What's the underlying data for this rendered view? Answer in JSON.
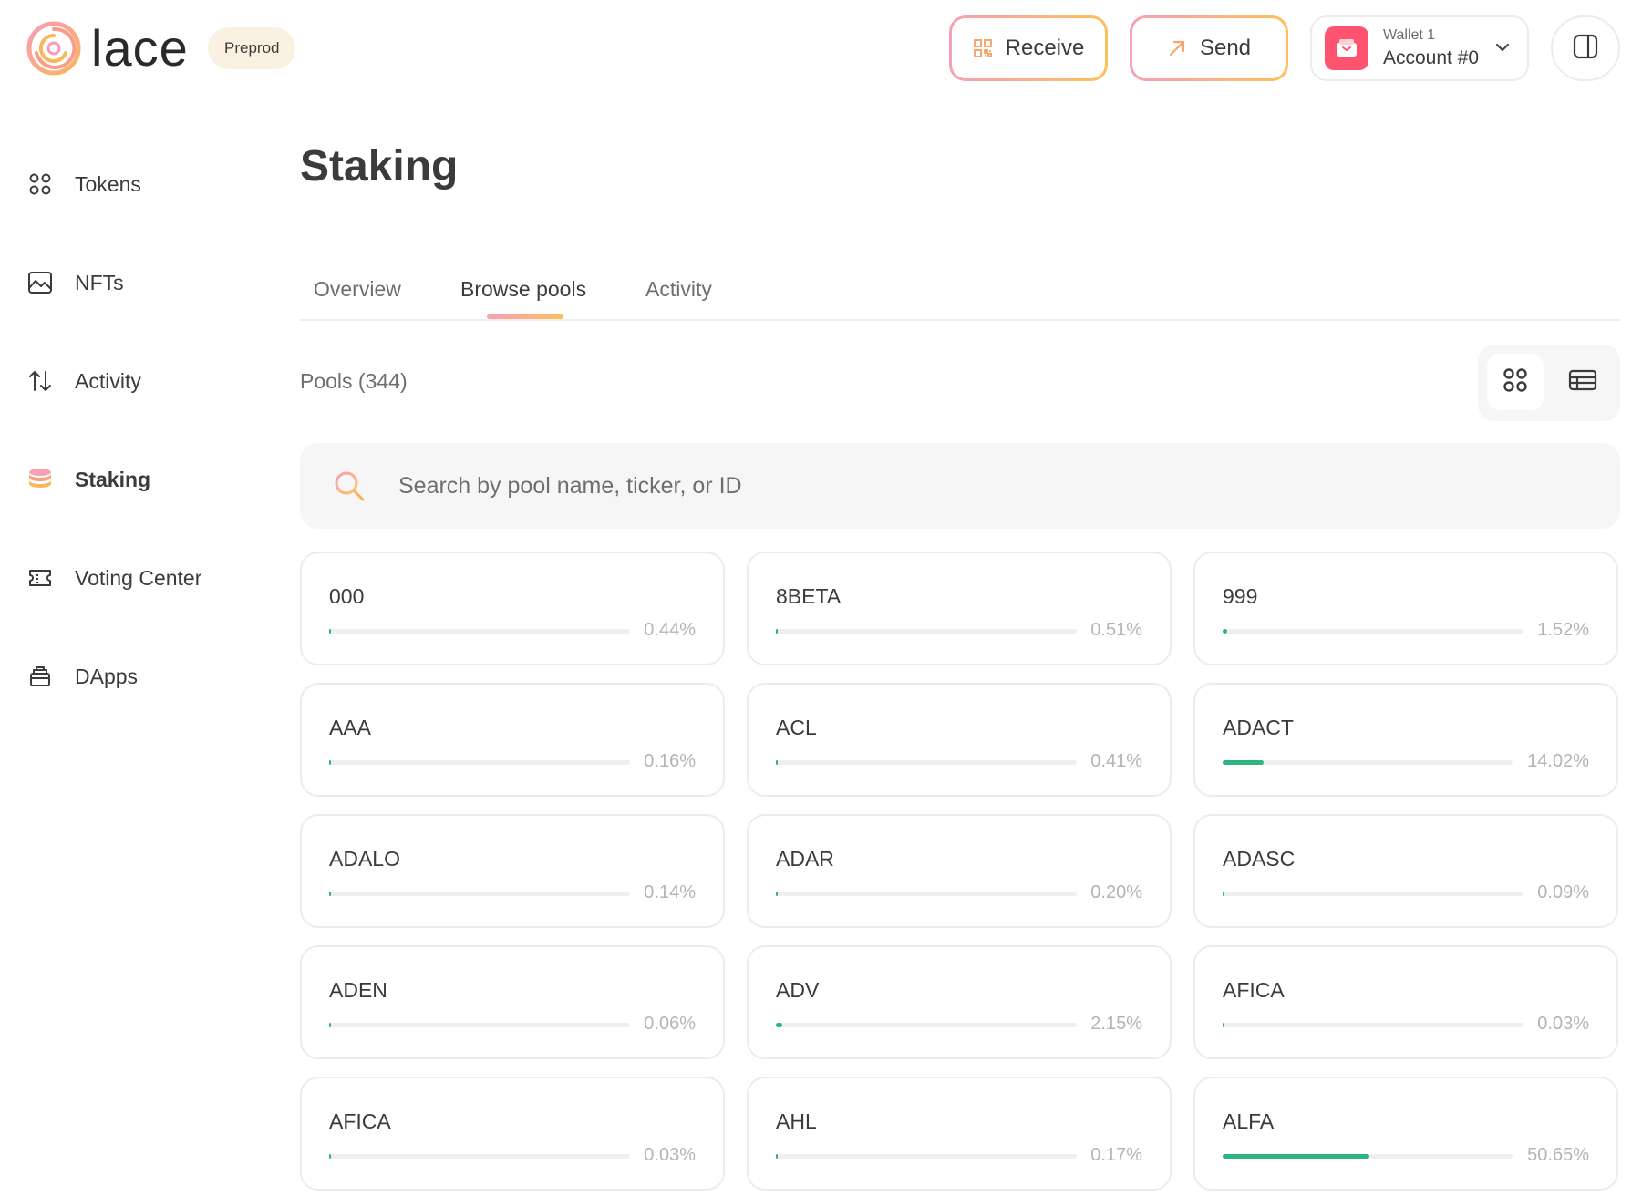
{
  "header": {
    "logo_text": "lace",
    "network_badge": "Preprod",
    "receive_label": "Receive",
    "send_label": "Send",
    "account": {
      "wallet": "Wallet 1",
      "name": "Account #0"
    }
  },
  "sidebar": {
    "items": [
      {
        "label": "Tokens",
        "icon": "grid-icon"
      },
      {
        "label": "NFTs",
        "icon": "image-icon"
      },
      {
        "label": "Activity",
        "icon": "arrows-up-down-icon"
      },
      {
        "label": "Staking",
        "icon": "coins-stack-icon",
        "active": true
      },
      {
        "label": "Voting Center",
        "icon": "ticket-icon"
      },
      {
        "label": "DApps",
        "icon": "box-icon"
      }
    ]
  },
  "main": {
    "title": "Staking",
    "tabs": [
      {
        "label": "Overview"
      },
      {
        "label": "Browse pools",
        "active": true
      },
      {
        "label": "Activity"
      }
    ],
    "pools_count": "Pools (344)",
    "search_placeholder": "Search by pool name, ticker, or ID",
    "pools": [
      {
        "ticker": "000",
        "saturation": "0.44%",
        "value": 0.44
      },
      {
        "ticker": "8BETA",
        "saturation": "0.51%",
        "value": 0.51
      },
      {
        "ticker": "999",
        "saturation": "1.52%",
        "value": 1.52
      },
      {
        "ticker": "AAA",
        "saturation": "0.16%",
        "value": 0.16
      },
      {
        "ticker": "ACL",
        "saturation": "0.41%",
        "value": 0.41
      },
      {
        "ticker": "ADACT",
        "saturation": "14.02%",
        "value": 14.02
      },
      {
        "ticker": "ADALO",
        "saturation": "0.14%",
        "value": 0.14
      },
      {
        "ticker": "ADAR",
        "saturation": "0.20%",
        "value": 0.2
      },
      {
        "ticker": "ADASC",
        "saturation": "0.09%",
        "value": 0.09
      },
      {
        "ticker": "ADEN",
        "saturation": "0.06%",
        "value": 0.06
      },
      {
        "ticker": "ADV",
        "saturation": "2.15%",
        "value": 2.15
      },
      {
        "ticker": "AFICA",
        "saturation": "0.03%",
        "value": 0.03
      },
      {
        "ticker": "AFICA",
        "saturation": "0.03%",
        "value": 0.03
      },
      {
        "ticker": "AHL",
        "saturation": "0.17%",
        "value": 0.17
      },
      {
        "ticker": "ALFA",
        "saturation": "50.65%",
        "value": 50.65
      }
    ]
  },
  "colors": {
    "accent_gradient_start": "#f6a0b7",
    "accent_gradient_end": "#fdc05a",
    "saturation_fill": "#2cb67d",
    "avatar": "#ff5470"
  }
}
